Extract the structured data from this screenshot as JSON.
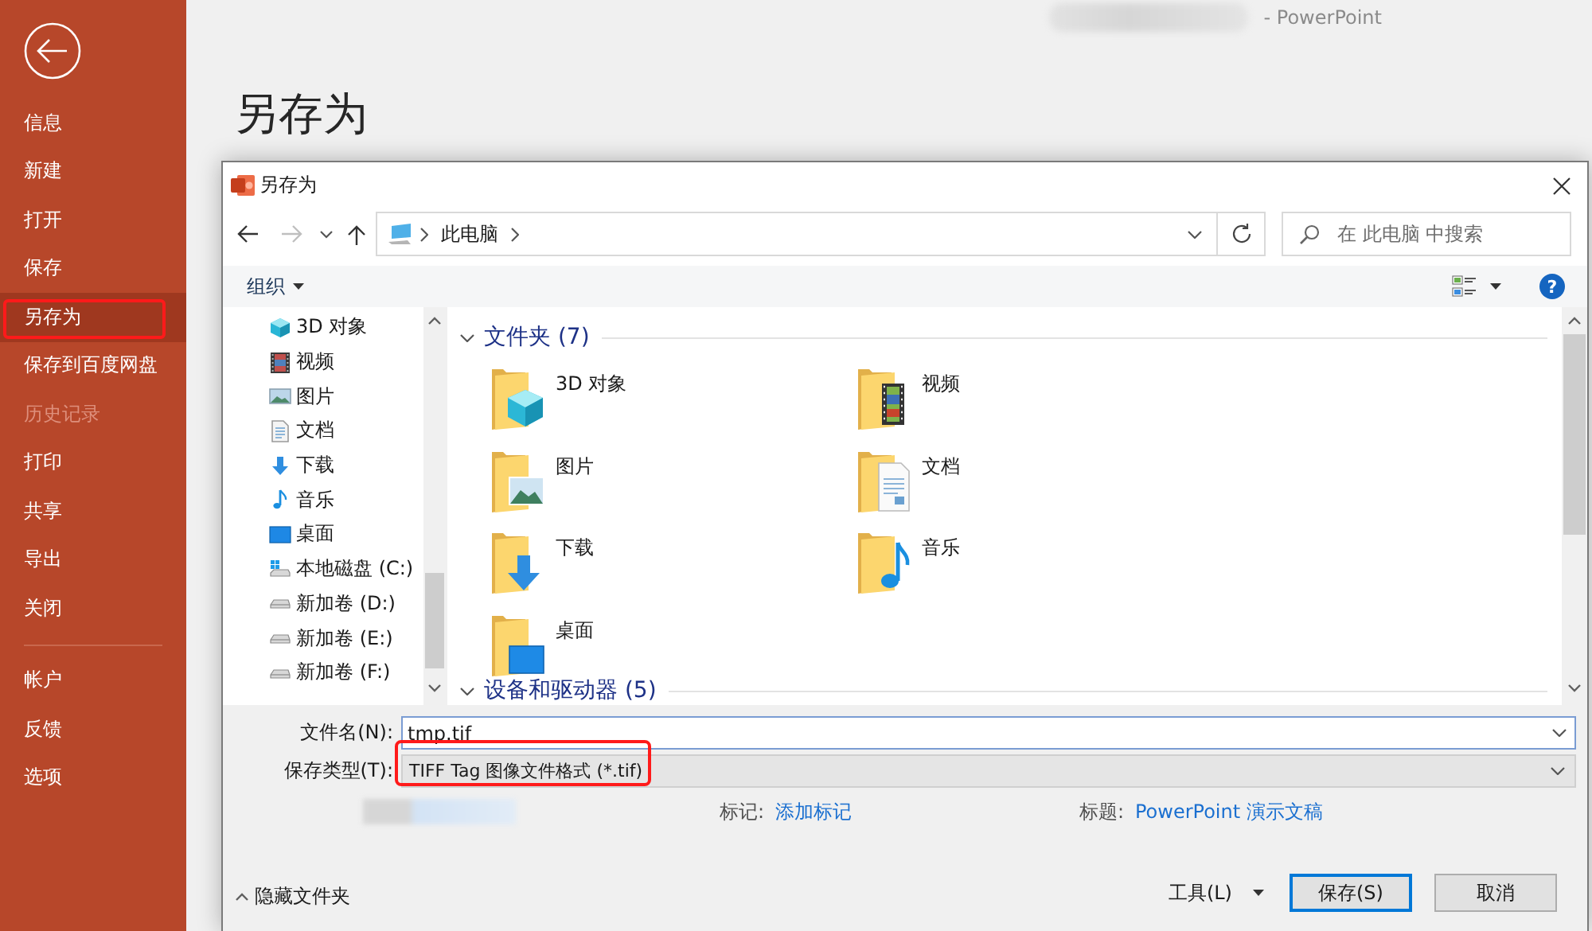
{
  "app": {
    "title_suffix": "- PowerPoint"
  },
  "backstage": {
    "items": [
      {
        "label": "信息",
        "selected": false,
        "disabled": false,
        "highlighted": false
      },
      {
        "label": "新建",
        "selected": false,
        "disabled": false,
        "highlighted": false
      },
      {
        "label": "打开",
        "selected": false,
        "disabled": false,
        "highlighted": false
      },
      {
        "label": "保存",
        "selected": false,
        "disabled": false,
        "highlighted": false
      },
      {
        "label": "另存为",
        "selected": true,
        "disabled": false,
        "highlighted": true
      },
      {
        "label": "保存到百度网盘",
        "selected": false,
        "disabled": false,
        "highlighted": false
      },
      {
        "label": "历史记录",
        "selected": false,
        "disabled": true,
        "highlighted": false
      },
      {
        "label": "打印",
        "selected": false,
        "disabled": false,
        "highlighted": false
      },
      {
        "label": "共享",
        "selected": false,
        "disabled": false,
        "highlighted": false
      },
      {
        "label": "导出",
        "selected": false,
        "disabled": false,
        "highlighted": false
      },
      {
        "label": "关闭",
        "selected": false,
        "disabled": false,
        "highlighted": false
      }
    ],
    "footer_items": [
      {
        "label": "帐户",
        "selected": false,
        "disabled": false,
        "highlighted": false
      },
      {
        "label": "反馈",
        "selected": false,
        "disabled": false,
        "highlighted": false
      },
      {
        "label": "选项",
        "selected": false,
        "disabled": false,
        "highlighted": false
      }
    ]
  },
  "page_title": "另存为",
  "dialog": {
    "title": "另存为",
    "address": {
      "path": [
        "此电脑"
      ]
    },
    "search": {
      "placeholder": "在 此电脑 中搜索"
    },
    "toolbar": {
      "organize": "组织",
      "help": "?"
    },
    "nav_items": [
      {
        "label": "3D 对象",
        "kind": "objects3d"
      },
      {
        "label": "视频",
        "kind": "video"
      },
      {
        "label": "图片",
        "kind": "pictures"
      },
      {
        "label": "文档",
        "kind": "documents"
      },
      {
        "label": "下载",
        "kind": "downloads"
      },
      {
        "label": "音乐",
        "kind": "music"
      },
      {
        "label": "桌面",
        "kind": "desktop"
      },
      {
        "label": "本地磁盘 (C:)",
        "kind": "system_drive"
      },
      {
        "label": "新加卷 (D:)",
        "kind": "drive"
      },
      {
        "label": "新加卷 (E:)",
        "kind": "drive"
      },
      {
        "label": "新加卷 (F:)",
        "kind": "drive"
      }
    ],
    "sections": [
      {
        "title": "文件夹 (7)",
        "expanded": true,
        "items": [
          {
            "label": "3D 对象",
            "kind": "objects3d"
          },
          {
            "label": "视频",
            "kind": "video"
          },
          {
            "label": "图片",
            "kind": "pictures"
          },
          {
            "label": "文档",
            "kind": "documents"
          },
          {
            "label": "下载",
            "kind": "downloads"
          },
          {
            "label": "音乐",
            "kind": "music"
          },
          {
            "label": "桌面",
            "kind": "desktop"
          }
        ]
      },
      {
        "title": "设备和驱动器 (5)",
        "expanded": true
      }
    ],
    "file_name": {
      "label": "文件名(N):",
      "value": "tmp.tif"
    },
    "save_type": {
      "label": "保存类型(T):",
      "value": "TIFF Tag 图像文件格式 (*.tif)",
      "highlighted": true
    },
    "properties": [
      {
        "label": "标记:",
        "value": "添加标记"
      },
      {
        "label": "标题:",
        "value": "PowerPoint 演示文稿"
      }
    ],
    "hide_folders": "隐藏文件夹",
    "tools": "工具(L)",
    "buttons": [
      {
        "label": "保存(S)",
        "default": true
      },
      {
        "label": "取消",
        "default": false
      }
    ]
  }
}
